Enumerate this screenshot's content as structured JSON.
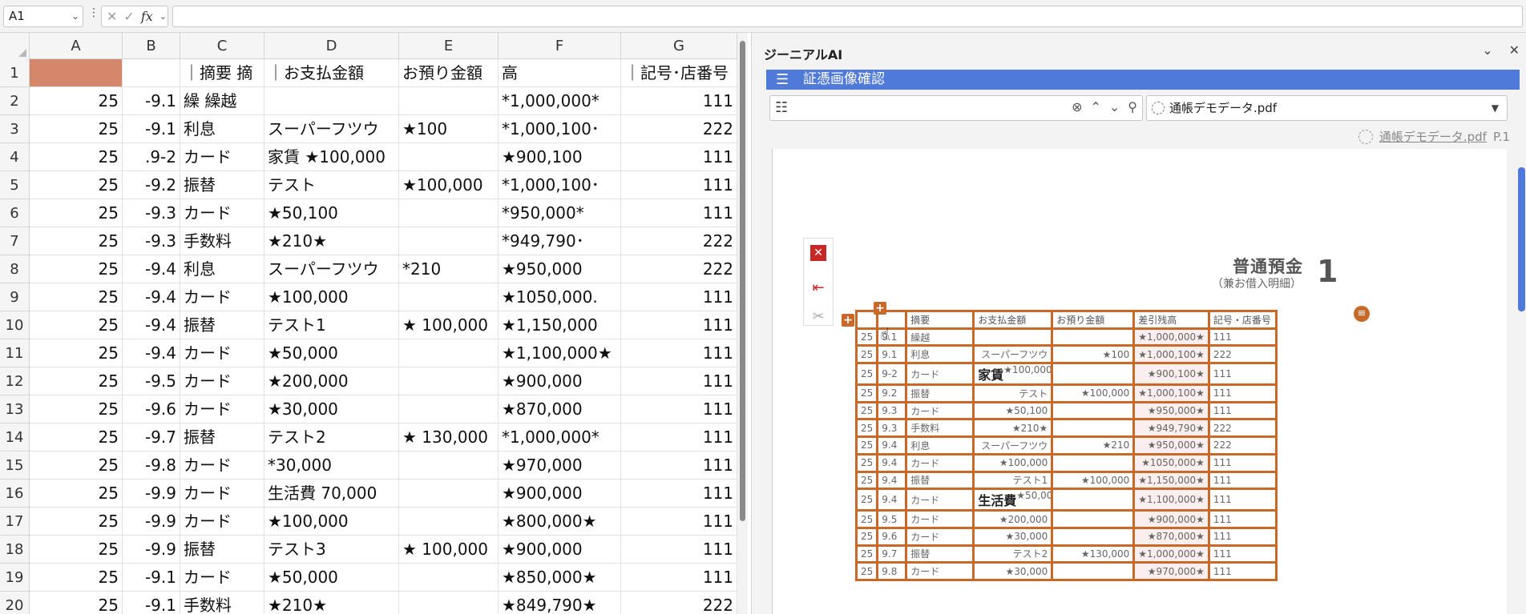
{
  "formula_bar": {
    "name_box": "A1",
    "fx": "fx",
    "formula": ""
  },
  "columns": [
    "A",
    "B",
    "C",
    "D",
    "E",
    "F",
    "G"
  ],
  "header_row": {
    "num": "1",
    "cells": [
      "",
      "",
      "｜摘要 摘",
      "｜お支払金額",
      "お預り金額",
      "高",
      "｜記号･店番号"
    ],
    "a_fill": "#d4876a"
  },
  "rows": [
    {
      "num": "2",
      "cells": [
        "25",
        "-9.1",
        "繰 繰越",
        "",
        "",
        "*1,000,000*",
        "111"
      ]
    },
    {
      "num": "3",
      "cells": [
        "25",
        "-9.1",
        "利息",
        "スーパーフツウ",
        "★100",
        "*1,000,100･",
        "222"
      ]
    },
    {
      "num": "4",
      "cells": [
        "25",
        ".9-2",
        "カード",
        "家賃 ★100,000",
        "",
        "★900,100",
        "111"
      ]
    },
    {
      "num": "5",
      "cells": [
        "25",
        "-9.2",
        "振替",
        " テスト",
        "★100,000",
        "*1,000,100･",
        "111"
      ]
    },
    {
      "num": "6",
      "cells": [
        "25",
        "-9.3",
        "カード",
        "★50,100",
        "",
        "*950,000*",
        "111"
      ]
    },
    {
      "num": "7",
      "cells": [
        "25",
        "-9.3",
        "手数料",
        "★210★",
        "",
        "*949,790･",
        "222"
      ]
    },
    {
      "num": "8",
      "cells": [
        "25",
        "-9.4",
        "利息",
        "スーパーフツウ",
        "*210",
        "★950,000",
        "222"
      ]
    },
    {
      "num": "9",
      "cells": [
        "25",
        "-9.4",
        "カード",
        "★100,000",
        "",
        "★1050,000.",
        "111"
      ]
    },
    {
      "num": "10",
      "cells": [
        "25",
        "-9.4",
        "振替",
        "テスト1",
        "★ 100,000",
        "★1,150,000",
        "111"
      ]
    },
    {
      "num": "11",
      "cells": [
        "25",
        "-9.4",
        "カード",
        "★50,000",
        "",
        "★1,100,000★",
        "111"
      ]
    },
    {
      "num": "12",
      "cells": [
        "25",
        "-9.5",
        "カード",
        "★200,000",
        "",
        "★900,000",
        "111"
      ]
    },
    {
      "num": "13",
      "cells": [
        "25",
        "-9.6",
        "カード",
        "★30,000",
        "",
        "★870,000",
        "111"
      ]
    },
    {
      "num": "14",
      "cells": [
        "25",
        "-9.7",
        "振替",
        "テスト2",
        "★ 130,000",
        "*1,000,000*",
        "111"
      ]
    },
    {
      "num": "15",
      "cells": [
        "25",
        "-9.8",
        "カード",
        "*30,000",
        "",
        "★970,000",
        "111"
      ]
    },
    {
      "num": "16",
      "cells": [
        "25",
        "-9.9",
        "カード",
        "生活費 70,000",
        "",
        "★900,000",
        "111"
      ]
    },
    {
      "num": "17",
      "cells": [
        "25",
        "-9.9",
        "カード",
        "★100,000",
        "",
        "★800,000★",
        "111"
      ]
    },
    {
      "num": "18",
      "cells": [
        "25",
        "-9.9",
        "振替",
        "テスト3",
        "★ 100,000",
        "★900,000",
        "111"
      ]
    },
    {
      "num": "19",
      "cells": [
        "25",
        "-9.1",
        "カード",
        "★50,000",
        "",
        "★850,000★",
        "111"
      ]
    },
    {
      "num": "20",
      "cells": [
        "25",
        "-9.1",
        "手数料",
        "★210★",
        "",
        "★849,790★",
        "222"
      ]
    }
  ],
  "panel": {
    "title": "ジーニアルAI",
    "header": "証憑画像確認",
    "search_placeholder": "",
    "file_select": "通帳デモデータ.pdf",
    "file_link": "通帳デモデータ.pdf",
    "page_label": "P.1"
  },
  "document": {
    "title": "普通預金",
    "subtitle": "（兼お借入明細）",
    "page_num": "1",
    "headers": [
      "",
      "",
      "摘要",
      "お支払金額",
      "お預り金額",
      "差引残高",
      "記号・店番号"
    ],
    "rows": [
      [
        "25",
        "9.1",
        "繰越",
        "",
        "",
        "★1,000,000★",
        "111"
      ],
      [
        "25",
        "9.1",
        "利息",
        "スーパーフツウ",
        "★100",
        "★1,000,100★",
        "222"
      ],
      [
        "25",
        "9-2",
        "カード",
        "★100,000",
        "",
        "★900,100★",
        "111"
      ],
      [
        "25",
        "9.2",
        "振替",
        "テスト",
        "★100,000",
        "★1,000,100★",
        "111"
      ],
      [
        "25",
        "9.3",
        "カード",
        "★50,100",
        "",
        "★950,000★",
        "111"
      ],
      [
        "25",
        "9.3",
        "手数料",
        "★210★",
        "",
        "★949,790★",
        "222"
      ],
      [
        "25",
        "9.4",
        "利息",
        "スーパーフツウ",
        "★210",
        "★950,000★",
        "222"
      ],
      [
        "25",
        "9.4",
        "カード",
        "★100,000",
        "",
        "★1050,000★",
        "111"
      ],
      [
        "25",
        "9.4",
        "振替",
        "テスト1",
        "★100,000",
        "★1,150,000★",
        "111"
      ],
      [
        "25",
        "9.4",
        "カード",
        "★50,000",
        "",
        "★1,100,000★",
        "111"
      ],
      [
        "25",
        "9.5",
        "カード",
        "★200,000",
        "",
        "★900,000★",
        "111"
      ],
      [
        "25",
        "9.6",
        "カード",
        "★30,000",
        "",
        "★870,000★",
        "111"
      ],
      [
        "25",
        "9.7",
        "振替",
        "テスト2",
        "★130,000",
        "★1,000,000★",
        "111"
      ],
      [
        "25",
        "9.8",
        "カード",
        "★30,000",
        "",
        "★970,000★",
        "111"
      ]
    ],
    "handwriting": {
      "row3": "家賃",
      "row10": "生活費"
    }
  }
}
